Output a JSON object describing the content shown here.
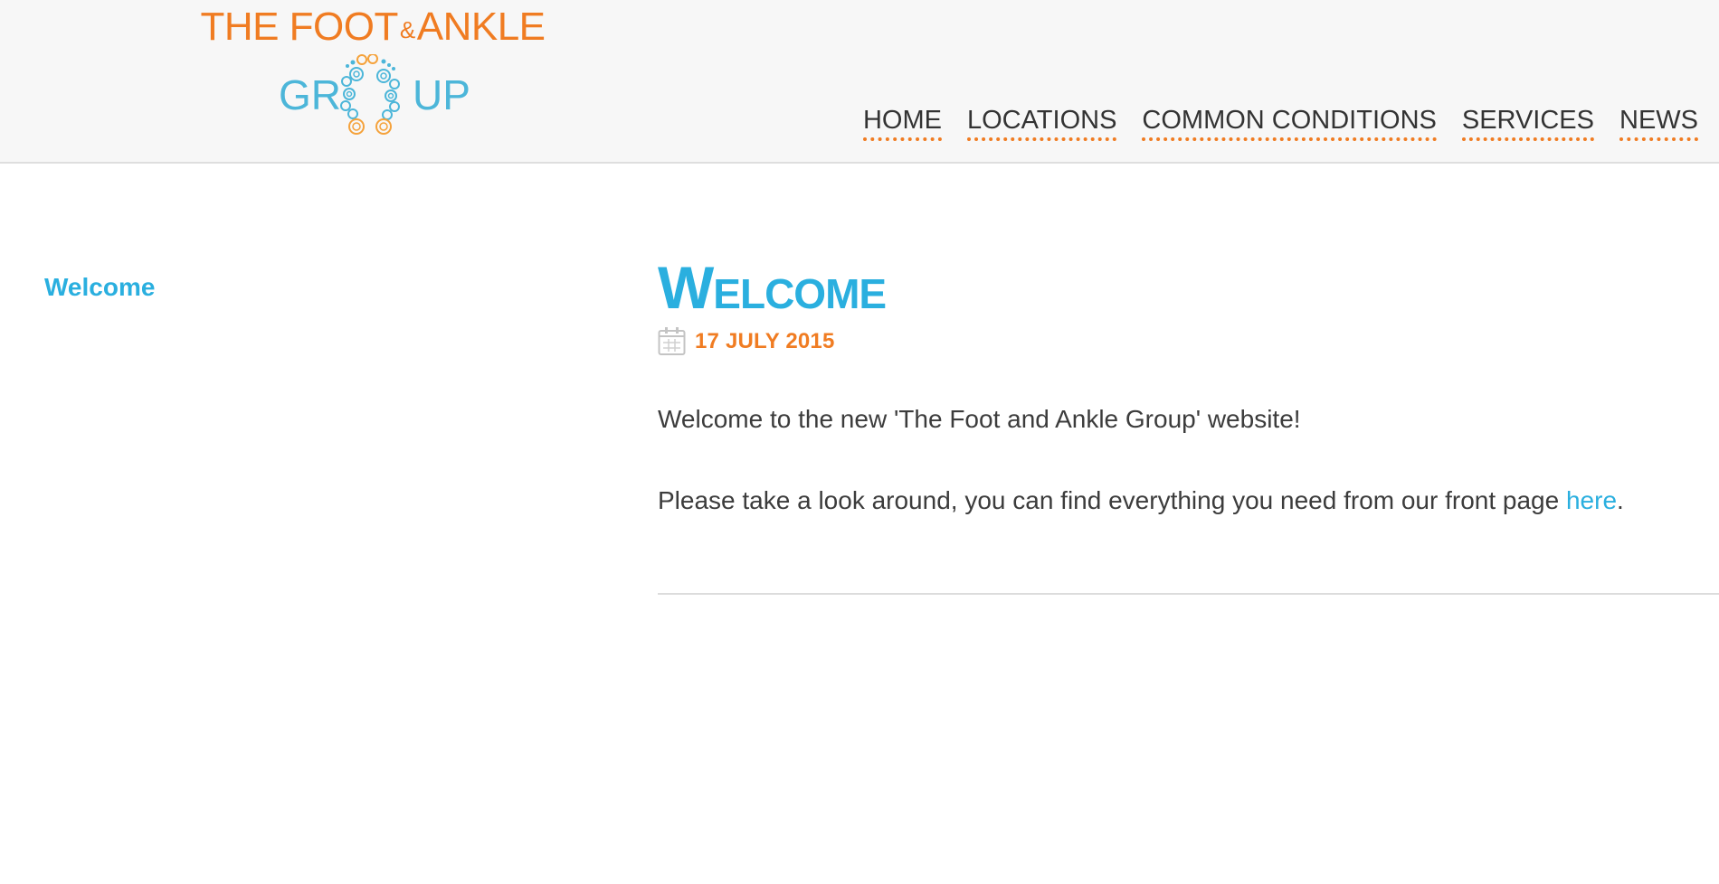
{
  "logo": {
    "line1_part1": "THE FOOT",
    "line1_amp": "&",
    "line1_part2": "ANKLE",
    "line2_left": "GR",
    "line2_right": "UP"
  },
  "nav": {
    "items": [
      {
        "label": "HOME"
      },
      {
        "label": "LOCATIONS"
      },
      {
        "label": "COMMON CONDITIONS"
      },
      {
        "label": "SERVICES"
      },
      {
        "label": "NEWS"
      }
    ]
  },
  "sidebar": {
    "link_label": "Welcome"
  },
  "post": {
    "title": "Welcome",
    "date": "17 JULY 2015",
    "paragraph1": "Welcome to the new 'The Foot and Ankle Group' website!",
    "paragraph2_text": "Please take a look around, you can find everything you need from our front page ",
    "paragraph2_link": "here",
    "paragraph2_end": "."
  },
  "colors": {
    "brand_orange": "#f07c22",
    "brand_blue": "#2aafdf",
    "logo_blue": "#4cb6d9",
    "header_bg": "#f7f7f7",
    "text": "#3c3c3c"
  },
  "icons": {
    "date": "calendar-icon",
    "logo_mark": "footprints-icon"
  }
}
